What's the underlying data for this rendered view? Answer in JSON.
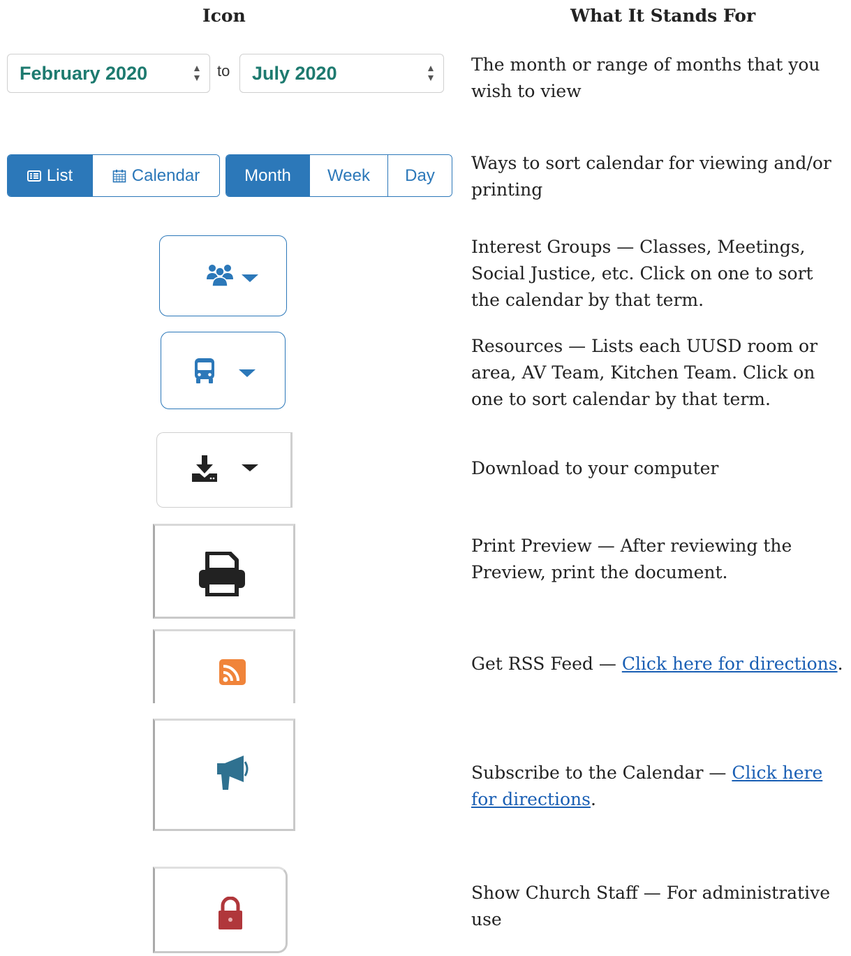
{
  "headers": {
    "icon": "Icon",
    "what": "What It Stands For"
  },
  "date_range": {
    "from": "February 2020",
    "to_label": "to",
    "to": "July 2020"
  },
  "view_buttons": {
    "list": "List",
    "calendar": "Calendar",
    "month": "Month",
    "week": "Week",
    "day": "Day"
  },
  "rows": [
    {
      "text": "The month or range of months that you wish to view"
    },
    {
      "text": "Ways to sort calendar for viewing and/or printing"
    },
    {
      "text": "Interest Groups — Classes, Meetings, Social Justice, etc. Click on one to sort the calendar by that term.",
      "icon": "users-icon"
    },
    {
      "text": "Resources — Lists each UUSD room or area, AV Team, Kitchen Team. Click on one to sort calendar by that term.",
      "icon": "bus-icon"
    },
    {
      "text": "Download to your computer",
      "icon": "download-icon"
    },
    {
      "text": "Print Preview — After reviewing the Preview, print the document.",
      "icon": "print-icon"
    },
    {
      "text_before": "Get RSS Feed — ",
      "link": "Click here for directions",
      "text_after": ".",
      "icon": "rss-icon"
    },
    {
      "text_before": "Subscribe to the Calendar — ",
      "link": "Click here for directions",
      "text_after": ".",
      "icon": "megaphone-icon"
    },
    {
      "text": "Show Church Staff — For administrative use",
      "icon": "lock-icon"
    }
  ],
  "colors": {
    "primary": "#2c78b9",
    "teal": "#1d7a6f",
    "rss": "#f0843a",
    "lock": "#b0373b",
    "megaphone": "#2f7190",
    "link": "#1a5fb4"
  }
}
